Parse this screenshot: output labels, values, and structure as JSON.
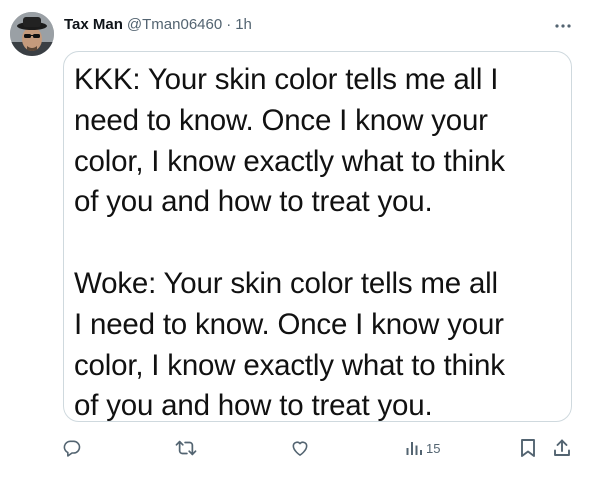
{
  "post": {
    "author": {
      "display_name": "Tax Man",
      "handle": "@Tman06460",
      "separator": "·",
      "time": "1h"
    },
    "image_text": {
      "paragraph_1": [
        "KKK: Your skin color tells me all I",
        "need to know. Once I know your",
        "color, I know exactly what to think",
        "of you and how to treat you."
      ],
      "paragraph_2": [
        "Woke: Your skin color tells me all",
        "I need to know. Once I know your",
        "color, I know exactly what to think",
        "of you and how to treat you."
      ]
    },
    "actions": {
      "reply_icon": "reply-icon",
      "repost_icon": "repost-icon",
      "like_icon": "heart-icon",
      "views_icon": "views-icon",
      "views_count": "15",
      "bookmark_icon": "bookmark-icon",
      "share_icon": "share-icon"
    },
    "more_icon": "more-icon"
  },
  "colors": {
    "text_primary": "#0f1419",
    "text_secondary": "#536471",
    "border": "#cfd9de"
  }
}
